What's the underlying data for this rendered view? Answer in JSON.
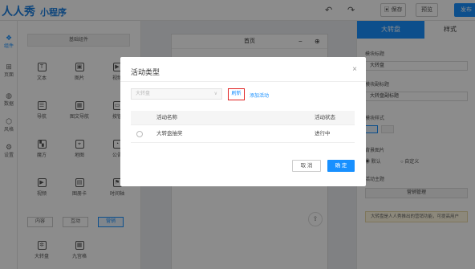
{
  "app": {
    "logo": "人人秀",
    "subtitle": "小程序"
  },
  "topbar": {
    "undo_icon": "undo-icon",
    "redo_icon": "redo-icon",
    "save": "保存",
    "preview": "预览",
    "publish": "发布"
  },
  "leftnav": [
    {
      "label": "组件",
      "icon": "component-icon"
    },
    {
      "label": "页面",
      "icon": "page-icon"
    },
    {
      "label": "数据",
      "icon": "data-icon"
    },
    {
      "label": "风格",
      "icon": "style-icon"
    },
    {
      "label": "设置",
      "icon": "settings-icon"
    }
  ],
  "components": {
    "header": "基础组件",
    "items": [
      {
        "label": "文本",
        "glyph": "T"
      },
      {
        "label": "图片",
        "glyph": "▣"
      },
      {
        "label": "视频",
        "glyph": "▶"
      },
      {
        "label": "导航",
        "glyph": "☰"
      },
      {
        "label": "图文导航",
        "glyph": "▦"
      },
      {
        "label": "按钮",
        "glyph": "▭"
      },
      {
        "label": "魔方",
        "glyph": "▚"
      },
      {
        "label": "地图",
        "glyph": "⌖"
      },
      {
        "label": "公告",
        "glyph": "◔"
      },
      {
        "label": "视频",
        "glyph": "▶"
      },
      {
        "label": "图册卡",
        "glyph": "▤"
      },
      {
        "label": "时间轴",
        "glyph": "⚑"
      }
    ],
    "tabs": [
      "内容",
      "互动",
      "营销"
    ],
    "marketing": [
      {
        "label": "大转盘",
        "glyph": "✲"
      },
      {
        "label": "九宫格",
        "glyph": "▦"
      }
    ]
  },
  "canvas": {
    "page_title": "首页"
  },
  "right": {
    "tabs": [
      "大转盘",
      "样式"
    ],
    "fields": [
      {
        "label": "模块标题",
        "value": "大转盘"
      },
      {
        "label": "模块副标题",
        "value": "大转盘副标题"
      }
    ],
    "style_label": "模块样式",
    "bg_label": "背景图片",
    "bg_default": "默认",
    "bg_custom": "自定义",
    "activity_label": "活动主题",
    "manage_button": "营销管理",
    "tip": "大转盘是人人秀推出的营销功能，可提高用户"
  },
  "modal": {
    "title": "活动类型",
    "select_placeholder": "大转盘",
    "refresh": "刷新",
    "add_activity": "添加活动",
    "columns": [
      "活动名称",
      "活动状态"
    ],
    "rows": [
      {
        "name": "大转盘抽奖",
        "status": "进行中"
      }
    ],
    "cancel": "取 消",
    "ok": "确 定"
  }
}
